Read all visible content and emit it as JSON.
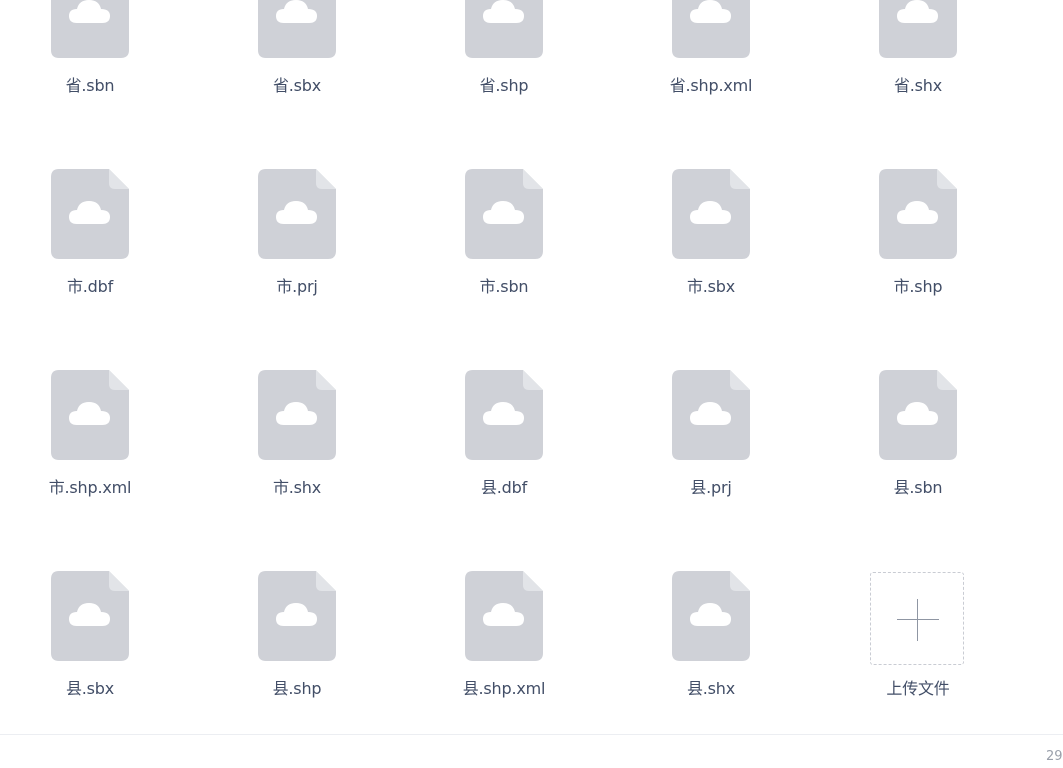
{
  "files": [
    {
      "name": "省.sbn"
    },
    {
      "name": "省.sbx"
    },
    {
      "name": "省.shp"
    },
    {
      "name": "省.shp.xml"
    },
    {
      "name": "省.shx"
    },
    {
      "name": "市.dbf"
    },
    {
      "name": "市.prj"
    },
    {
      "name": "市.sbn"
    },
    {
      "name": "市.sbx"
    },
    {
      "name": "市.shp"
    },
    {
      "name": "市.shp.xml"
    },
    {
      "name": "市.shx"
    },
    {
      "name": "县.dbf"
    },
    {
      "name": "县.prj"
    },
    {
      "name": "县.sbn"
    },
    {
      "name": "县.sbx"
    },
    {
      "name": "县.shp"
    },
    {
      "name": "县.shp.xml"
    },
    {
      "name": "县.shx"
    }
  ],
  "upload": {
    "label": "上传文件",
    "icon": "plus-icon"
  },
  "file_icon": "file-cloud-icon",
  "footer": {
    "text": "29"
  },
  "colors": {
    "icon_fill": "#cfd1d7",
    "icon_fold": "#e2e4e8",
    "label": "#424e67"
  }
}
